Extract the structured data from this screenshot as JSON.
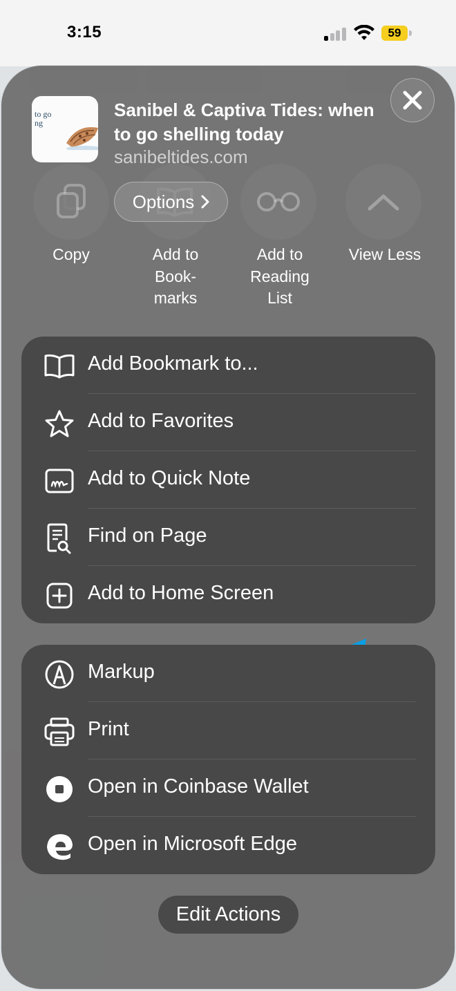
{
  "status_bar": {
    "time": "3:15",
    "battery": "59"
  },
  "share_sheet": {
    "page_title": "Sanibel & Captiva Tides: when to go shelling today",
    "page_domain": "sanibeltides.com",
    "thumbnail_text": "to go\nng",
    "options_label": "Options",
    "actions": [
      {
        "label": "Copy",
        "icon": "copy-icon"
      },
      {
        "label": "Add to Book-marks",
        "label_lines": [
          "Add to",
          "Book-",
          "marks"
        ],
        "icon": "book-icon"
      },
      {
        "label": "Add to Reading List",
        "label_lines": [
          "Add to",
          "Reading",
          "List"
        ],
        "icon": "glasses-icon"
      },
      {
        "label": "View Less",
        "icon": "chevron-up-icon"
      }
    ],
    "group1": [
      {
        "label": "Add Bookmark to...",
        "icon": "book-icon"
      },
      {
        "label": "Add to Favorites",
        "icon": "star-icon"
      },
      {
        "label": "Add to Quick Note",
        "icon": "quick-note-icon"
      },
      {
        "label": "Find on Page",
        "icon": "find-on-page-icon"
      },
      {
        "label": "Add to Home Screen",
        "icon": "add-square-icon"
      }
    ],
    "group2": [
      {
        "label": "Markup",
        "icon": "markup-icon"
      },
      {
        "label": "Print",
        "icon": "printer-icon"
      },
      {
        "label": "Open in Coinbase Wallet",
        "icon": "coinbase-icon"
      },
      {
        "label": "Open in Microsoft Edge",
        "icon": "edge-icon"
      }
    ],
    "edit_actions_label": "Edit Actions"
  },
  "colors": {
    "arrow": "#0a9fe3",
    "sheet": "#707070",
    "group": "#484849",
    "battery": "#f5ce1f"
  }
}
